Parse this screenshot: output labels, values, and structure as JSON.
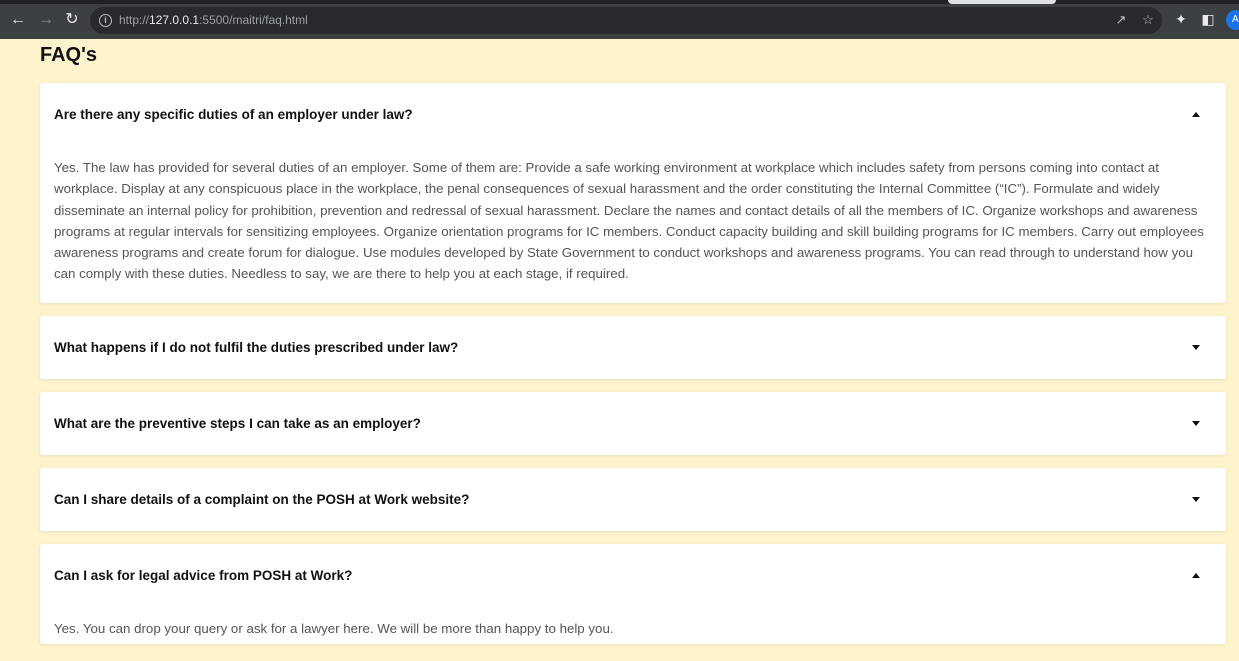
{
  "browser": {
    "url_prefix": "http://",
    "url_host": "127.0.0.1",
    "url_rest": ":5500/maitri/faq.html",
    "avatar_letter": "A",
    "icons": [
      "back-icon",
      "forward-icon",
      "reload-icon",
      "info-icon",
      "share-icon",
      "star-icon",
      "extensions-icon",
      "side-panel-icon"
    ]
  },
  "page": {
    "title": "FAQ's"
  },
  "faqs": [
    {
      "question": "Are there any specific duties of an employer under law?",
      "expanded": true,
      "answer": "Yes. The law has provided for several duties of an employer. Some of them are: Provide a safe working environment at workplace which includes safety from persons coming into contact at workplace. Display at any conspicuous place in the workplace, the penal consequences of sexual harassment and the order constituting the Internal Committee (“IC”). Formulate and widely disseminate an internal policy for prohibition, prevention and redressal of sexual harassment. Declare the names and contact details of all the members of IC. Organize workshops and awareness programs at regular intervals for sensitizing employees. Organize orientation programs for IC members. Conduct capacity building and skill building programs for IC members. Carry out employees awareness programs and create forum for dialogue. Use modules developed by State Government to conduct workshops and awareness programs. You can read through to understand how you can comply with these duties. Needless to say, we are there to help you at each stage, if required."
    },
    {
      "question": "What happens if I do not fulfil the duties prescribed under law?",
      "expanded": false,
      "answer": ""
    },
    {
      "question": "What are the preventive steps I can take as an employer?",
      "expanded": false,
      "answer": ""
    },
    {
      "question": "Can I share details of a complaint on the POSH at Work website?",
      "expanded": false,
      "answer": ""
    },
    {
      "question": "Can I ask for legal advice from POSH at Work?",
      "expanded": true,
      "answer": "Yes. You can drop your query or ask for a lawyer here. We will be more than happy to help you."
    }
  ]
}
